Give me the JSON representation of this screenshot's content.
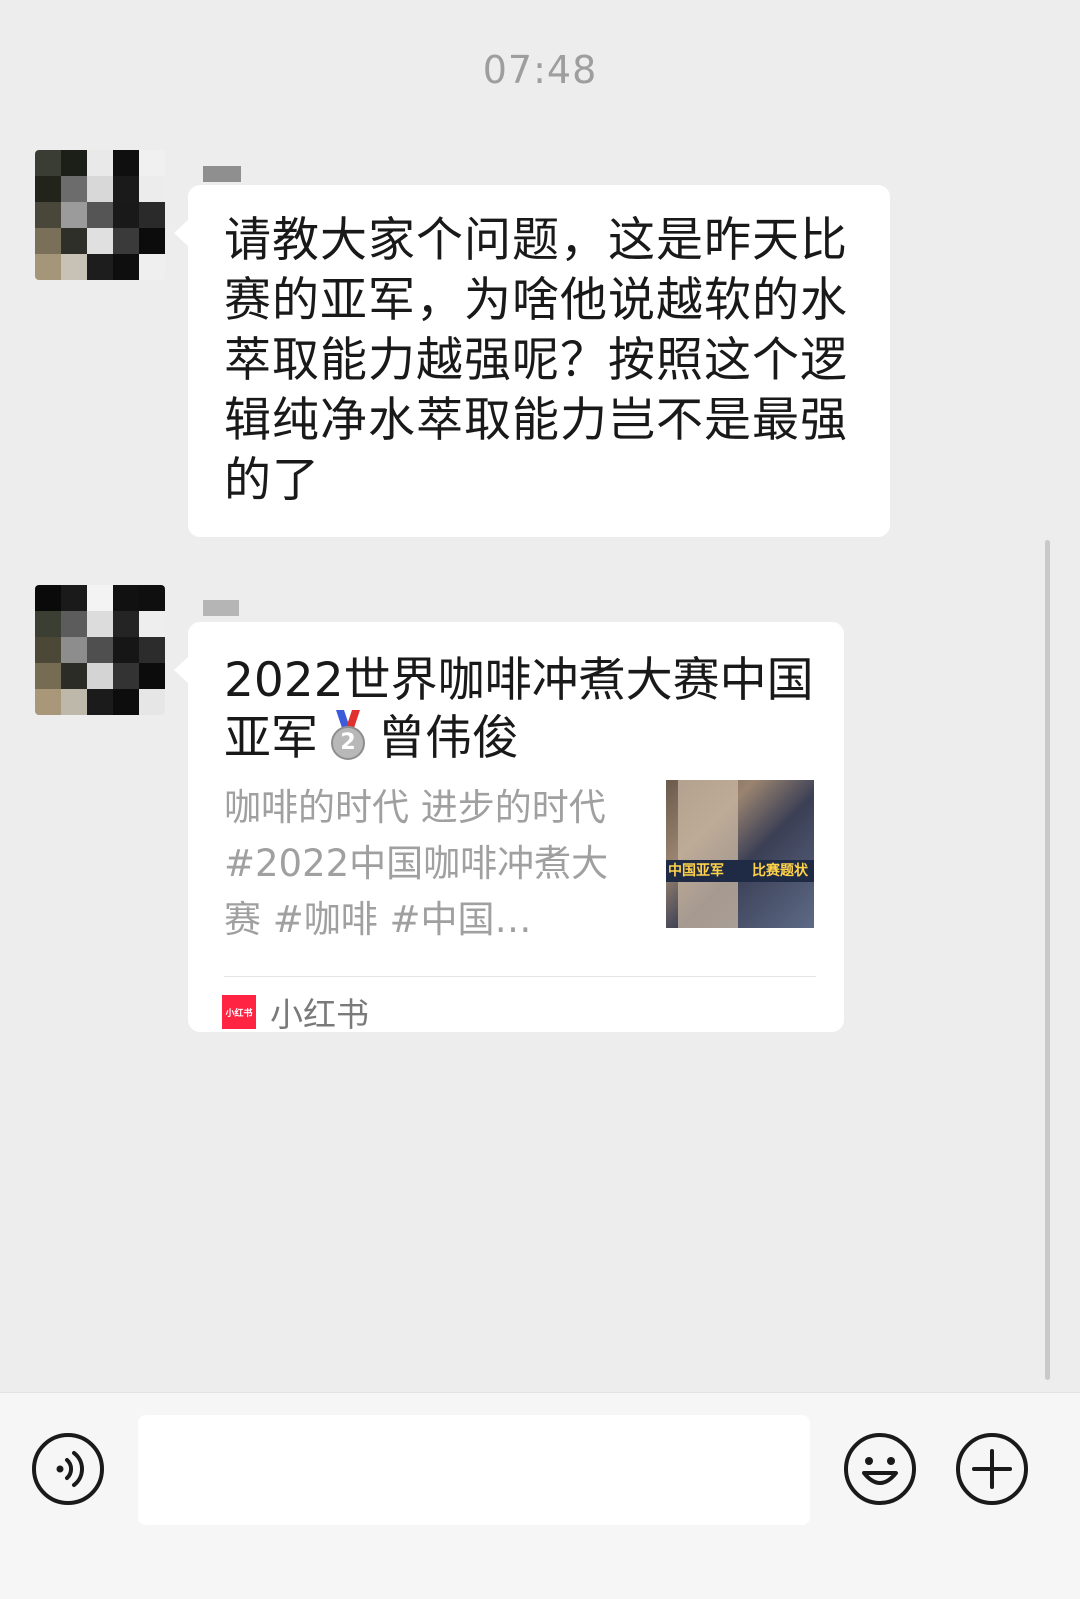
{
  "time": "07:48",
  "message1": {
    "text": "请教大家个问题，这是昨天比赛的亚军，为啥他说越软的水萃取能力越强呢？按照这个逻辑纯净水萃取能力岂不是最强的了"
  },
  "message2": {
    "card_title_a": "2022世界咖啡冲煮大赛中国亚军",
    "card_title_b": "曾伟俊",
    "medal_number": "2",
    "description": "咖啡的时代 进步的时代 #2022中国咖啡冲煮大赛 #咖啡 #中国…",
    "thumbnail_text_left": "中国亚军",
    "thumbnail_text_right": "比赛题状",
    "source_logo_text": "小红书",
    "source_name": "小红书"
  },
  "icons": {
    "voice": "voice-icon",
    "emoji": "emoji-icon",
    "plus": "plus-icon",
    "medal": "silver-medal-icon"
  },
  "colors": {
    "background": "#ededed",
    "bubble": "#ffffff",
    "xiaohongshu_red": "#ff2442"
  }
}
